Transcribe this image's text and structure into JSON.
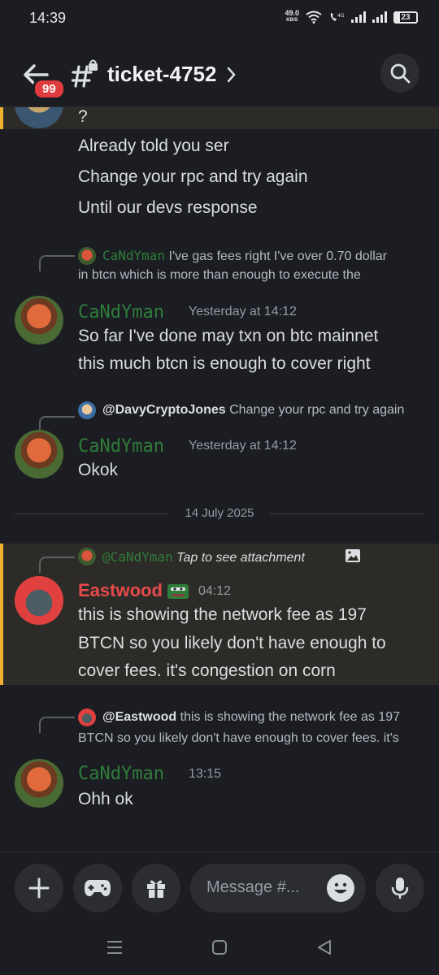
{
  "status_bar": {
    "time": "14:39",
    "net_speed": "49.0",
    "net_unit": "KB/S",
    "battery": "23",
    "icons": [
      "wifi-icon",
      "volte-icon",
      "signal-icon",
      "signal-icon",
      "battery-icon"
    ]
  },
  "header": {
    "back_icon": "arrow-left-icon",
    "badge": "99",
    "channel_icon": "locked-hash-icon",
    "channel_name": "ticket-4752",
    "chevron_icon": "chevron-right-icon",
    "search_icon": "search-icon"
  },
  "messages": {
    "m1": {
      "lines": [
        "?",
        "Already told you ser",
        "Change your rpc and try again",
        "Until our devs response"
      ]
    },
    "m2": {
      "reply_author": "CaNdYman",
      "reply_line1": "I've gas fees right I've over 0.70 dollar",
      "reply_line2": "in btcn which is more than enough to execute the",
      "author": "CaNdYman",
      "timestamp": "Yesterday at 14:12",
      "lines": [
        "So far I've done may txn on btc mainnet",
        "this much btcn is enough to cover right"
      ]
    },
    "m3": {
      "reply_author": "@DavyCryptoJones",
      "reply_text": "Change your rpc and try again",
      "author": "CaNdYman",
      "timestamp": "Yesterday at 14:12",
      "lines": [
        "Okok"
      ]
    },
    "divider": "14 July 2025",
    "m4": {
      "reply_author": "@CaNdYman",
      "reply_text": "Tap to see attachment",
      "author": "Eastwood",
      "timestamp": "04:12",
      "lines": [
        "this is showing the network fee as 197",
        "BTCN so you likely don't have enough to",
        "cover fees. it's congestion on corn"
      ]
    },
    "m5": {
      "reply_author": "@Eastwood",
      "reply_line1": "this is showing the network fee as 197",
      "reply_line2": "BTCN so you likely don't have enough to cover fees. it's",
      "author": "CaNdYman",
      "timestamp": "13:15",
      "lines": [
        "Ohh ok"
      ]
    }
  },
  "composer": {
    "placeholder": "Message #...",
    "buttons": [
      "plus-icon",
      "gamepad-icon",
      "gift-icon",
      "emoji-icon",
      "microphone-icon"
    ]
  },
  "colors": {
    "background": "#1c1d22",
    "highlight": "#2d2b27",
    "highlight_bar": "#f0b132",
    "candyman": "#2e7d3a",
    "eastwood": "#e64b4b",
    "badge": "#e03b3e"
  }
}
